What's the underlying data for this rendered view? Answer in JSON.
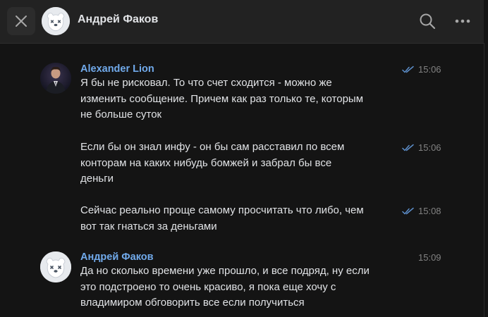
{
  "header": {
    "title": "Андрей Факов"
  },
  "icons": {
    "close": "close-icon",
    "search": "search-icon",
    "more": "more-horizontal-icon",
    "read_receipt": "double-check-icon"
  },
  "colors": {
    "accent": "#71aaeb",
    "background": "#141414",
    "header": "#222222",
    "text": "#e1e3e6",
    "secondary_text": "#828282"
  },
  "messages": [
    {
      "author": "Alexander Lion",
      "time": "15:06",
      "read": true,
      "lines": [
        "Я бы не рисковал. То что счет сходится - можно же",
        "изменить сообщение. Причем как раз только те, которым",
        "не больше суток"
      ]
    },
    {
      "author": "",
      "time": "15:06",
      "read": true,
      "lines": [
        "Если бы он знал инфу - он бы сам расставил по всем",
        "конторам на каких нибудь бомжей и забрал бы все",
        "деньги"
      ]
    },
    {
      "author": "",
      "time": "15:08",
      "read": true,
      "lines": [
        "Сейчас реально проще самому просчитать что либо, чем",
        "вот так гнаться за деньгами"
      ]
    },
    {
      "author": "Андрей Факов",
      "time": "15:09",
      "read": false,
      "lines": [
        "Да но сколько времени уже прошло, и все подряд, ну если",
        "это подстроено то очень красиво, я пока еще хочу с",
        "владимиром обговорить все если получиться"
      ]
    }
  ]
}
